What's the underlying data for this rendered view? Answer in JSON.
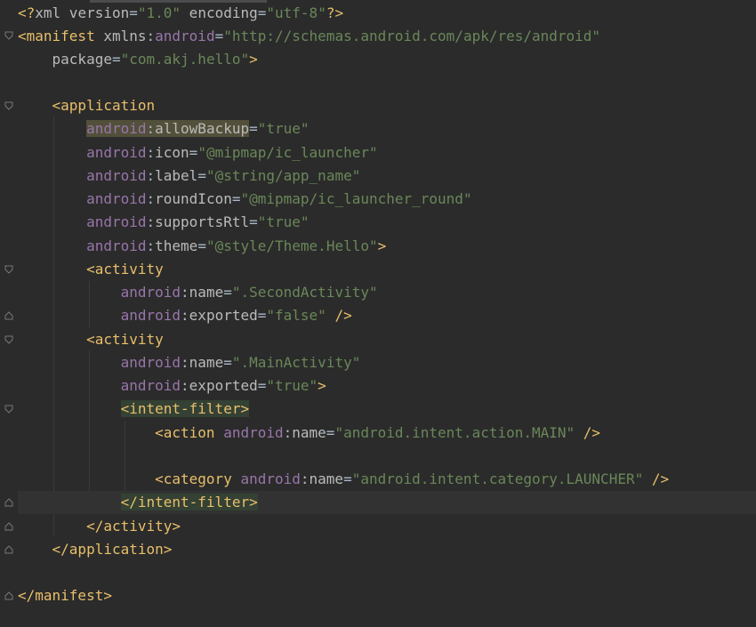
{
  "editor": {
    "colors": {
      "background": "#2b2b2b",
      "tag": "#e8bf6a",
      "namespace": "#9876aa",
      "attribute": "#bababa",
      "value": "#6a8759"
    },
    "lines": {
      "l1": {
        "prolog_open": "<?",
        "prolog_name": "xml",
        "version_attr": " version",
        "eq": "=",
        "version_val": "\"1.0\"",
        "encoding_attr": " encoding",
        "encoding_val": "\"utf-8\"",
        "prolog_close": "?>"
      },
      "l2": {
        "open": "<manifest",
        "xmlns": " xmlns",
        "colon": ":",
        "ns": "android",
        "eq": "=",
        "val": "\"http://schemas.android.com/apk/res/android\""
      },
      "l3": {
        "attr": "package",
        "eq": "=",
        "val": "\"com.akj.hello\"",
        "close": ">"
      },
      "l5": {
        "open": "<application"
      },
      "l6": {
        "ns": "android",
        "colon": ":",
        "attr": "allowBackup",
        "eq": "=",
        "val": "\"true\""
      },
      "l7": {
        "ns": "android",
        "colon": ":",
        "attr": "icon",
        "eq": "=",
        "val": "\"@mipmap/ic_launcher\""
      },
      "l8": {
        "ns": "android",
        "colon": ":",
        "attr": "label",
        "eq": "=",
        "val": "\"@string/app_name\""
      },
      "l9": {
        "ns": "android",
        "colon": ":",
        "attr": "roundIcon",
        "eq": "=",
        "val": "\"@mipmap/ic_launcher_round\""
      },
      "l10": {
        "ns": "android",
        "colon": ":",
        "attr": "supportsRtl",
        "eq": "=",
        "val": "\"true\""
      },
      "l11": {
        "ns": "android",
        "colon": ":",
        "attr": "theme",
        "eq": "=",
        "val": "\"@style/Theme.Hello\"",
        "close": ">"
      },
      "l12": {
        "open": "<activity"
      },
      "l13": {
        "ns": "android",
        "colon": ":",
        "attr": "name",
        "eq": "=",
        "val": "\".SecondActivity\""
      },
      "l14": {
        "ns": "android",
        "colon": ":",
        "attr": "exported",
        "eq": "=",
        "val": "\"false\"",
        "close": " />"
      },
      "l15": {
        "open": "<activity"
      },
      "l16": {
        "ns": "android",
        "colon": ":",
        "attr": "name",
        "eq": "=",
        "val": "\".MainActivity\""
      },
      "l17": {
        "ns": "android",
        "colon": ":",
        "attr": "exported",
        "eq": "=",
        "val": "\"true\"",
        "close": ">"
      },
      "l18": {
        "open": "<intent-filter>"
      },
      "l19": {
        "open": "<action",
        "ns": " android",
        "colon": ":",
        "attr": "name",
        "eq": "=",
        "val": "\"android.intent.action.MAIN\"",
        "close": " />"
      },
      "l21": {
        "open": "<category",
        "ns": " android",
        "colon": ":",
        "attr": "name",
        "eq": "=",
        "val": "\"android.intent.category.LAUNCHER\"",
        "close": " />"
      },
      "l22": {
        "close": "</intent-filter>"
      },
      "l23": {
        "close": "</activity>"
      },
      "l24": {
        "close": "</application>"
      },
      "l26": {
        "close": "</manifest>"
      }
    }
  }
}
